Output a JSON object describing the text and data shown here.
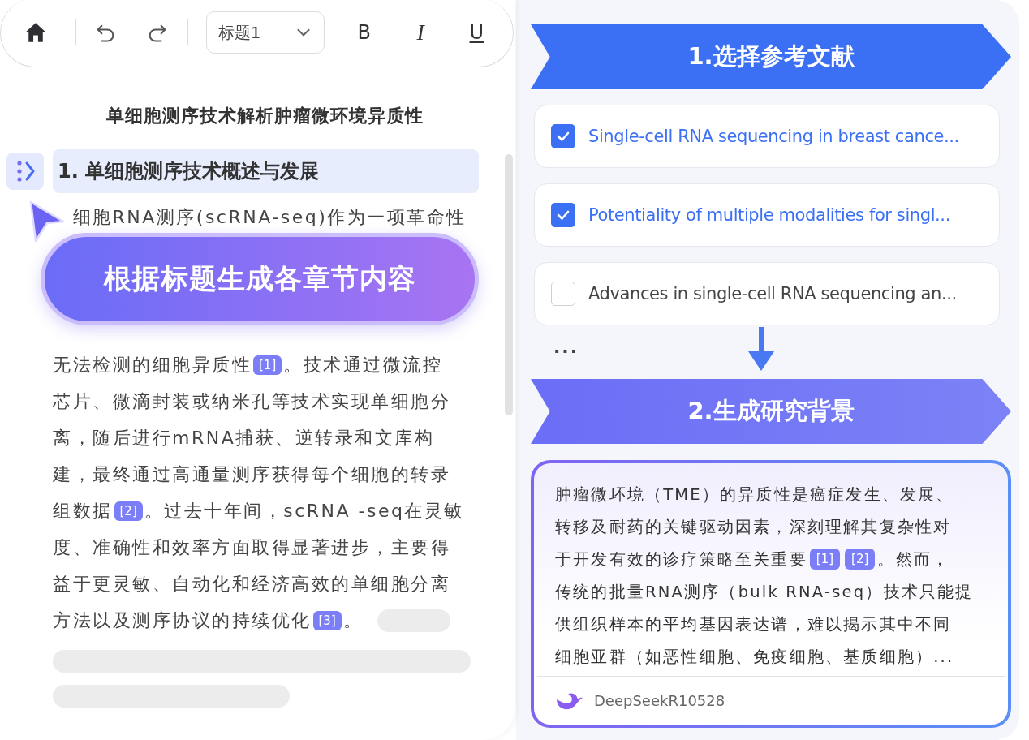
{
  "toolbar": {
    "style_select": {
      "value": "标题1"
    },
    "format_buttons": [
      {
        "kind": "bold",
        "label": "B"
      },
      {
        "kind": "italic",
        "label": "I"
      },
      {
        "kind": "underline",
        "label": "U"
      }
    ]
  },
  "document": {
    "title": "单细胞测序技术解析肿瘤微环境异质性",
    "heading": {
      "text": "1. 单细胞测序技术概述与发展",
      "selected": true
    },
    "lines": [
      [
        {
          "kind": "text",
          "text": "细胞RNA测序(scRNA-seq)作为一项革命性"
        }
      ],
      [
        {
          "kind": "text",
          "text": "无法检测的细胞异质性"
        },
        {
          "kind": "ref",
          "text": "[1]"
        },
        {
          "kind": "text",
          "text": "。技术通过微流控"
        }
      ],
      [
        {
          "kind": "text",
          "text": "芯片、微滴封装或纳米孔等技术实现单细胞分"
        }
      ],
      [
        {
          "kind": "text",
          "text": "离，随后进行mRNA捕获、逆转录和文库构"
        }
      ],
      [
        {
          "kind": "text",
          "text": "建，最终通过高通量测序获得每个细胞的转录"
        }
      ],
      [
        {
          "kind": "text",
          "text": "组数据"
        },
        {
          "kind": "ref",
          "text": "[2]"
        },
        {
          "kind": "text",
          "text": " 。过去十年间，scRNA -seq在灵敏"
        }
      ],
      [
        {
          "kind": "text",
          "text": "度、准确性和效率方面取得显著进步，主要得"
        }
      ],
      [
        {
          "kind": "text",
          "text": "益于更灵敏、自动化和经济高效的单细胞分离"
        }
      ],
      [
        {
          "kind": "text",
          "text": "方法以及测序协议的持续优化 "
        },
        {
          "kind": "ref",
          "text": "[3]"
        },
        {
          "kind": "text",
          "text": " 。"
        }
      ]
    ],
    "action_button": "根据标题生成各章节内容"
  },
  "step_1": {
    "label": "1.选择参考文献"
  },
  "references": [
    {
      "title": "Single-cell RNA sequencing in breast cance...",
      "checked": true
    },
    {
      "title": "Potentiality of multiple modalities for singl...",
      "checked": true
    },
    {
      "title": "Advances in single-cell RNA sequencing an...",
      "checked": false
    }
  ],
  "more": "...",
  "step_2": {
    "label": "2.生成研究背景"
  },
  "result": {
    "lines": [
      [
        {
          "kind": "text",
          "text": "肿瘤微环境（TME）的异质性是癌症发生、发展、"
        }
      ],
      [
        {
          "kind": "text",
          "text": "转移及耐药的关键驱动因素，深刻理解其复杂性对"
        }
      ],
      [
        {
          "kind": "text",
          "text": "于开发有效的诊疗策略至关重要 "
        },
        {
          "kind": "ref",
          "text": "[1]"
        },
        {
          "kind": "ref",
          "text": "[2]"
        },
        {
          "kind": "text",
          "text": "。然而，"
        }
      ],
      [
        {
          "kind": "text",
          "text": "传统的批量RNA测序（bulk RNA-seq）技术只能提"
        }
      ],
      [
        {
          "kind": "text",
          "text": "供组织样本的平均基因表达谱，难以揭示其中不同"
        }
      ],
      [
        {
          "kind": "text",
          "text": "细胞亚群（如恶性细胞、免疫细胞、基质细胞）..."
        }
      ]
    ],
    "model": "DeepSeekR10528"
  }
}
